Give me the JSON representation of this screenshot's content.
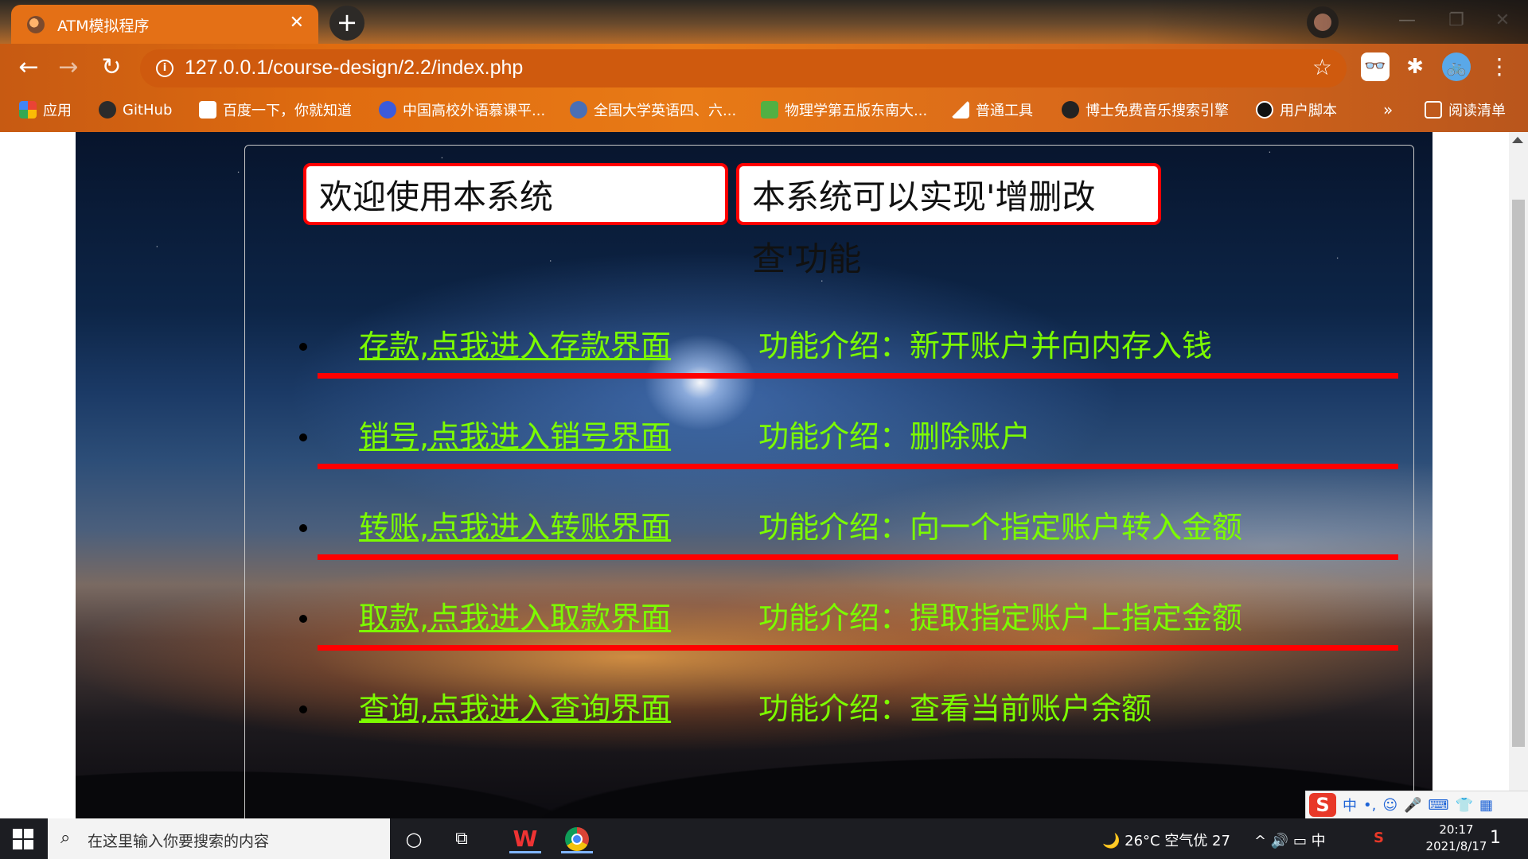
{
  "browser": {
    "tab_title": "ATM模拟程序",
    "tab_close": "✕",
    "new_tab": "+",
    "url": "127.0.0.1/course-design/2.2/index.php",
    "window_controls": [
      "—",
      "❐",
      "✕"
    ],
    "nav": {
      "back": "←",
      "forward": "→",
      "reload": "↻",
      "info": "i",
      "star": "☆"
    },
    "extensions": {
      "glasses": "👓",
      "puzzle": "✱",
      "bike": "🚲",
      "menu": "⋮"
    },
    "bookmarks": [
      {
        "label": "应用",
        "icon": "apps-grid-icon",
        "color": "#e44d26"
      },
      {
        "label": "GitHub",
        "icon": "github-icon",
        "color": "#333333"
      },
      {
        "label": "百度一下，你就知道",
        "icon": "baidu-icon",
        "color": "#2932e1"
      },
      {
        "label": "中国高校外语慕课平...",
        "icon": "umooc-icon",
        "color": "#3b5bdb"
      },
      {
        "label": "全国大学英语四、六...",
        "icon": "cet-icon",
        "color": "#4a6fb5"
      },
      {
        "label": "物理学第五版东南大...",
        "icon": "physics-icon",
        "color": "#52b043"
      },
      {
        "label": "普通工具",
        "icon": "folder-icon",
        "color": "#ffffff"
      },
      {
        "label": "博士免费音乐搜索引擎",
        "icon": "music-icon",
        "color": "#222222"
      },
      {
        "label": "用户脚本",
        "icon": "userscript-icon",
        "color": "#111111"
      }
    ],
    "bookmarks_overflow": "»",
    "reading_list": "阅读清单"
  },
  "page": {
    "welcome": "欢迎使用本系统",
    "intro": "本系统可以实现'增删改查'功能",
    "menu": [
      {
        "link": "存款,点我进入存款界面",
        "desc": "功能介绍：新开账户并向内存入钱"
      },
      {
        "link": "销号,点我进入销号界面",
        "desc": "功能介绍：删除账户"
      },
      {
        "link": "转账,点我进入转账界面",
        "desc": "功能介绍：向一个指定账户转入金额"
      },
      {
        "link": "取款,点我进入取款界面",
        "desc": "功能介绍：提取指定账户上指定金额"
      },
      {
        "link": "查询,点我进入查询界面",
        "desc": "功能介绍：查看当前账户余额"
      }
    ],
    "colors": {
      "link": "#7cfc00",
      "border": "#ff0000"
    }
  },
  "ime": {
    "logo": "S",
    "lang": "中",
    "punct": "•,",
    "emoji": "☺",
    "mic": "🎤",
    "keyboard": "⌨",
    "shirt": "👕",
    "grid": "▦"
  },
  "taskbar": {
    "search_placeholder": "在这里输入你要搜索的内容",
    "weather": "🌙 26°C 空气优 27",
    "tray_icons": "^ 🔊 ▭ 中",
    "time": "20:17",
    "date": "2021/8/17",
    "notifications": "1"
  }
}
